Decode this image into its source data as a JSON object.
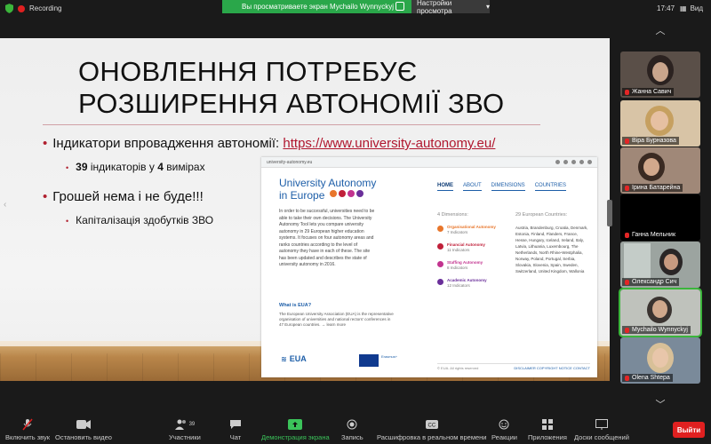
{
  "topbar": {
    "recording_label": "Recording",
    "share_message": "Вы просматриваете экран Mychailo Wynnyckyj",
    "view_options_label": "Настройки просмотра",
    "clock": "17:47",
    "view_label": "Вид"
  },
  "slide": {
    "title": "ОНОВЛЕННЯ ПОТРЕБУЄ РОЗШИРЕННЯ АВТОНОМІЇ ЗВО",
    "bullet1_text": "Індикатори впровадження автономії:",
    "bullet1_link": "https://www.university-autonomy.eu/",
    "sub1_bold_count": "39",
    "sub1_text_a": "індикаторів у",
    "sub1_bold_dims": "4",
    "sub1_text_b": "вимірах",
    "bullet2_text": "Грошей нема і не буде!!!",
    "sub2_text": "Капіталізація  здобутків ЗВО"
  },
  "website": {
    "url": "university-autonomy.eu",
    "logo_line1": "University Autonomy",
    "logo_line2": "in Europe",
    "nav": [
      "HOME",
      "ABOUT",
      "DIMENSIONS",
      "COUNTRIES"
    ],
    "intro": "In order to be successful, universities need to be able to take their own decisions. The University Autonomy Tool lets you compare university autonomy in 29 European higher education systems. It focuses on four autonomy areas and ranks countries according to the level of autonomy they have in each of these. The site has been updated and describes the state of university autonomy in 2016.",
    "what_heading": "What is EUA?",
    "what_text": "The European University Association (EUA) is the representative organisation of universities and national rectors' conferences in 47 European countries. → learn more",
    "eua_label": "EUA",
    "erasmus_label": "Erasmus+",
    "dims_heading": "4 Dimensions:",
    "dimensions": [
      {
        "name": "Organisational Autonomy",
        "indicators": "7 Indicators",
        "color": "#e8762b"
      },
      {
        "name": "Financial Autonomy",
        "indicators": "11 Indicators",
        "color": "#c0203a"
      },
      {
        "name": "Staffing Autonomy",
        "indicators": "8 Indicators",
        "color": "#c2338f"
      },
      {
        "name": "Academic Autonomy",
        "indicators": "12 Indicators",
        "color": "#6a2f9a"
      }
    ],
    "countries_heading": "29 European Countries:",
    "countries": "Austria, Brandenburg, Croatia, Denmark, Estonia, Finland, Flanders, France, Hesse, Hungary, Iceland, Ireland, Italy, Latvia, Lithuania, Luxembourg, The Netherlands, North Rhine-Westphalia, Norway, Poland, Portugal, Serbia, Slovakia, Slovenia, Spain, Sweden, Switzerland, United Kingdom, Wallonia",
    "footer_left": "© EUA. All rights reserved",
    "footer_links": "DISCLAIMER  COPYRIGHT NOTICE  CONTACT"
  },
  "participants": [
    {
      "name": "Жанна Савич",
      "muted": true,
      "active": false
    },
    {
      "name": "Віра Бурназова",
      "muted": true,
      "active": false
    },
    {
      "name": "Ірина Батарейна",
      "muted": true,
      "active": false
    },
    {
      "name": "Ганна Мельник",
      "muted": true,
      "active": false
    },
    {
      "name": "Олександр Сич",
      "muted": true,
      "active": false
    },
    {
      "name": "Mychailo Wynnyckyj",
      "muted": true,
      "active": true
    },
    {
      "name": "Olena Shtepa",
      "muted": true,
      "active": false
    }
  ],
  "toolbar": {
    "mute": "Включить звук",
    "video": "Остановить видео",
    "participants": "Участники",
    "participants_count": "39",
    "chat": "Чат",
    "share": "Демонстрация экрана",
    "record": "Запись",
    "transcript": "Расшифровка в реальном времени",
    "reactions": "Реакции",
    "apps": "Приложения",
    "whiteboard": "Доски сообщений",
    "leave": "Выйти"
  },
  "colors": {
    "accent_red": "#b0202f",
    "zoom_green": "#2aa74a",
    "leave_red": "#e02020"
  }
}
